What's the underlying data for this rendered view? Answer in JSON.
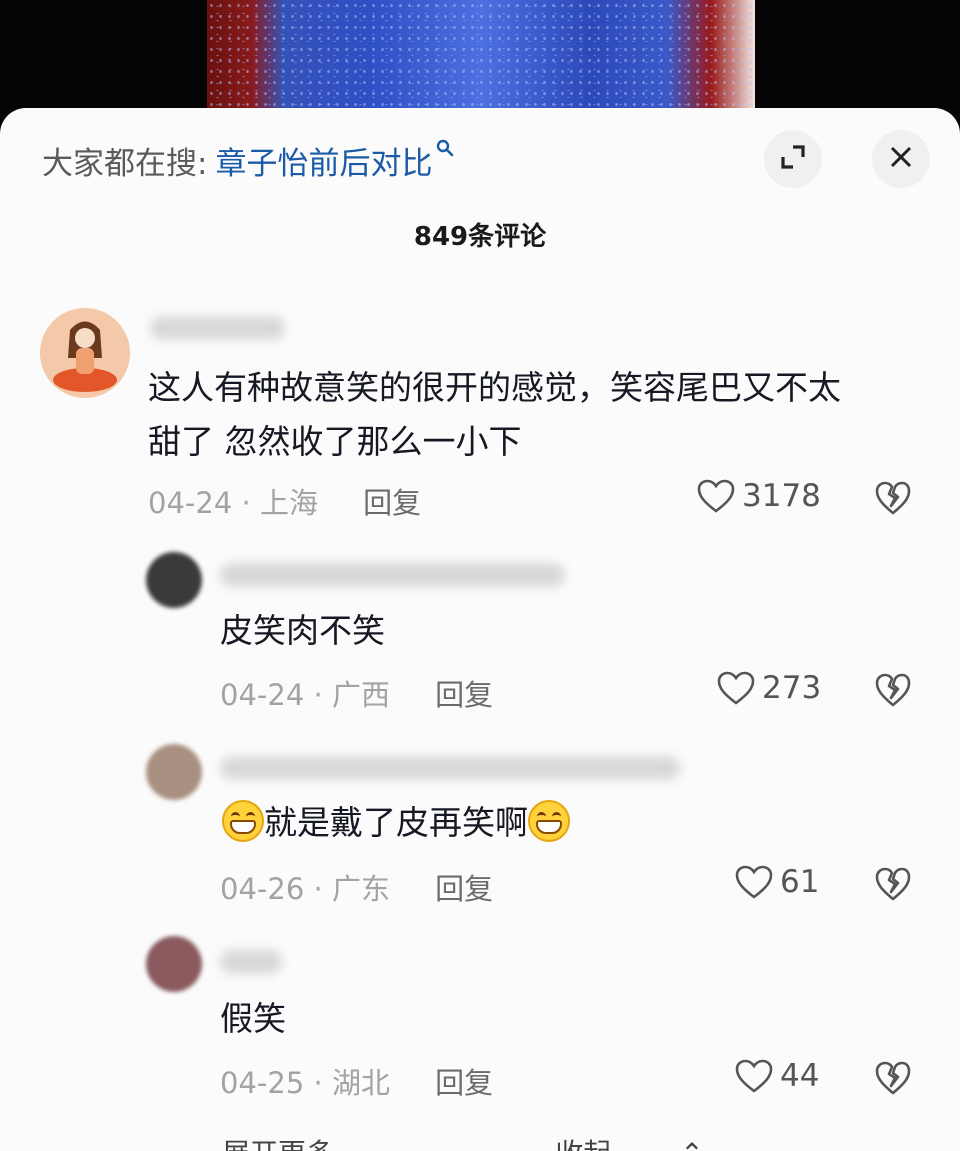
{
  "search": {
    "prefix": "大家都在搜:",
    "term": "章子怡前后对比",
    "icon": "search-icon"
  },
  "header": {
    "expand_icon": "expand-icon",
    "close_icon": "close-icon",
    "comment_count": "849条评论"
  },
  "comments": [
    {
      "text_line1": "这人有种故意笑的很开的感觉，笑容尾巴又不太",
      "text_line2": "甜了 忽然收了那么一小下",
      "date": "04-24",
      "location": "上海",
      "reply": "回复",
      "likes": "3178"
    },
    {
      "text": "皮笑肉不笑",
      "date": "04-24",
      "location": "广西",
      "reply": "回复",
      "likes": "273"
    },
    {
      "text": "就是戴了皮再笑啊",
      "date": "04-26",
      "location": "广东",
      "reply": "回复",
      "likes": "61"
    },
    {
      "text": "假笑",
      "date": "04-25",
      "location": "湖北",
      "reply": "回复",
      "likes": "44"
    }
  ],
  "footer": {
    "expand_more": "展开更多",
    "collapse": "收起"
  },
  "colors": {
    "sheet_bg": "#fbfbfb",
    "link_blue": "#1a5aa6",
    "meta_gray": "#a3a3a3"
  }
}
